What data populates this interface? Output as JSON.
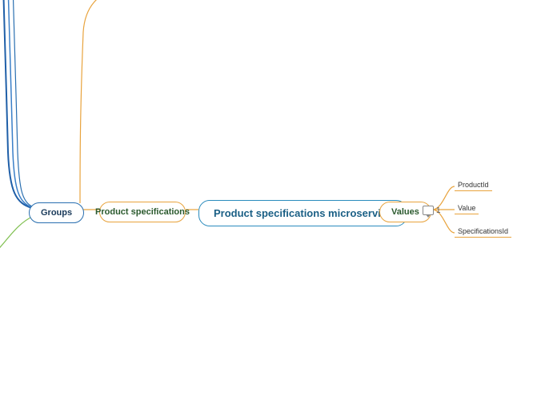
{
  "center": {
    "label": "Product specifications microservice"
  },
  "left1": {
    "label": "Product specifications"
  },
  "left2": {
    "label": "Groups"
  },
  "right1": {
    "label": "Values"
  },
  "comment": {
    "count": "1"
  },
  "leaves": {
    "a": "ProductId",
    "b": "Value",
    "c": "SpecificationsId"
  }
}
